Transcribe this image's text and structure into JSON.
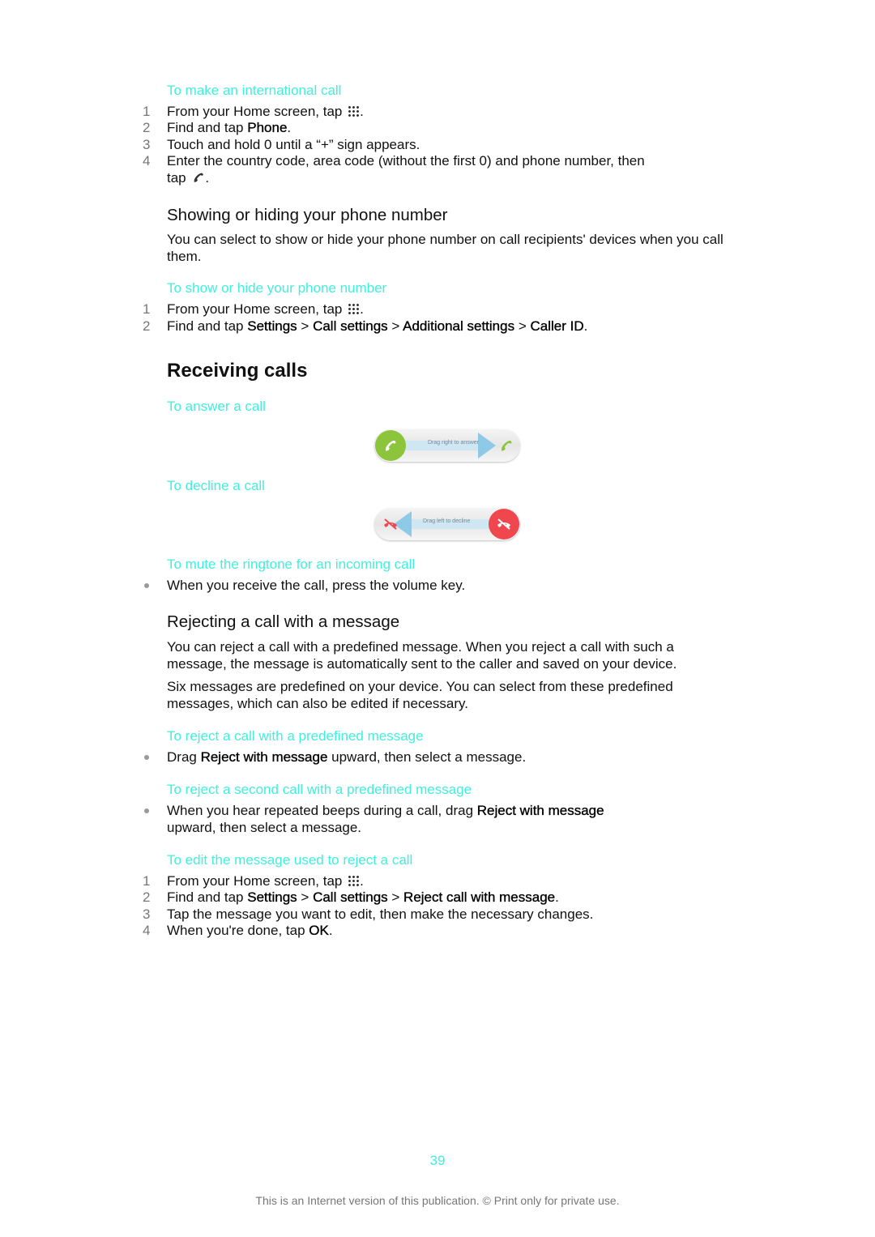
{
  "sections": {
    "international_call": {
      "title": "To make an international call",
      "steps": [
        {
          "num": "1",
          "pre": "From your Home screen, tap ",
          "icon": "apps-grid-icon",
          "post": "."
        },
        {
          "num": "2",
          "pre": "Find and tap ",
          "bold": "Phone",
          "post": "."
        },
        {
          "num": "3",
          "text": "Touch and hold 0 until a “+” sign appears."
        },
        {
          "num": "4",
          "line1": "Enter the country code, area code (without the first 0) and phone number, then",
          "line2_pre": "tap ",
          "icon": "call-icon",
          "line2_post": "."
        }
      ]
    },
    "show_hide": {
      "heading": "Showing or hiding your phone number",
      "para": "You can select to show or hide your phone number on call recipients' devices when you call them.",
      "proc_title": "To show or hide your phone number",
      "steps": [
        {
          "num": "1",
          "pre": "From your Home screen, tap ",
          "icon": "apps-grid-icon",
          "post": "."
        },
        {
          "num": "2",
          "pre": "Find and tap ",
          "b1": "Settings",
          "sep1": " > ",
          "b2": "Call settings",
          "sep2": " > ",
          "b3": "Additional settings",
          "sep3": " > ",
          "b4": "Caller ID",
          "post": "."
        }
      ]
    },
    "receiving": {
      "heading": "Receiving calls",
      "answer_title": "To answer a call",
      "answer_slider_label": "Drag right to answer",
      "decline_title": "To decline a call",
      "decline_slider_label": "Drag left to decline",
      "mute_title": "To mute the ringtone for an incoming call",
      "mute_step": "When you receive the call, press the volume key."
    },
    "rejecting": {
      "heading": "Rejecting a call with a message",
      "para1": "You can reject a call with a predefined message. When you reject a call with such a message, the message is automatically sent to the caller and saved on your device.",
      "para2": "Six messages are predefined on your device. You can select from these predefined messages, which can also be edited if necessary.",
      "reject_title": "To reject a call with a predefined message",
      "reject_step": {
        "pre": "Drag ",
        "bold": "Reject with message",
        "post": " upward, then select a message."
      },
      "reject_second_title": "To reject a second call with a predefined message",
      "reject_second_step": {
        "pre": "When you hear repeated beeps during a call, drag ",
        "bold": "Reject with message",
        "line2": "upward, then select a message."
      },
      "edit_title": "To edit the message used to reject a call",
      "edit_steps": [
        {
          "num": "1",
          "pre": "From your Home screen, tap ",
          "icon": "apps-grid-icon",
          "post": "."
        },
        {
          "num": "2",
          "pre": "Find and tap ",
          "b1": "Settings",
          "sep1": " > ",
          "b2": "Call settings",
          "sep2": " > ",
          "b3": "Reject call with message",
          "post": "."
        },
        {
          "num": "3",
          "text": "Tap the message you want to edit, then make the necessary changes."
        },
        {
          "num": "4",
          "pre": "When you're done, tap ",
          "bold": "OK",
          "post": "."
        }
      ]
    }
  },
  "footer": {
    "page_number": "39",
    "note": "This is an Internet version of this publication. © Print only for private use."
  },
  "colors": {
    "accent": "#3ff0dc",
    "answer_green": "#8cc43c",
    "decline_red": "#f0474f",
    "arrow_blue": "#8ec9e8"
  }
}
